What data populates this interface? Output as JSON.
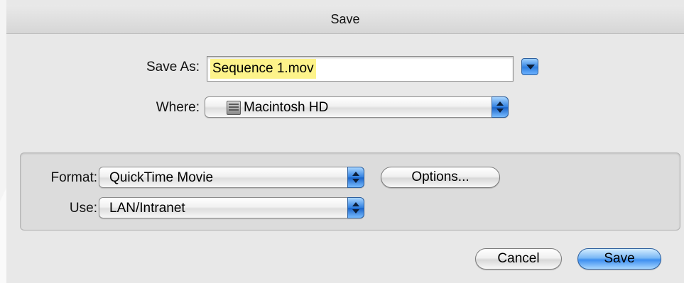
{
  "window": {
    "title": "Save"
  },
  "save_as": {
    "label": "Save As:",
    "value": "Sequence 1.mov"
  },
  "where": {
    "label": "Where:",
    "value": "Macintosh HD",
    "icon": "hard-drive-icon"
  },
  "format": {
    "label": "Format:",
    "value": "QuickTime Movie"
  },
  "use": {
    "label": "Use:",
    "value": "LAN/Intranet"
  },
  "buttons": {
    "options": "Options...",
    "cancel": "Cancel",
    "save": "Save"
  },
  "colors": {
    "highlight": "#fdf38a",
    "accent": "#3d8ef0"
  }
}
